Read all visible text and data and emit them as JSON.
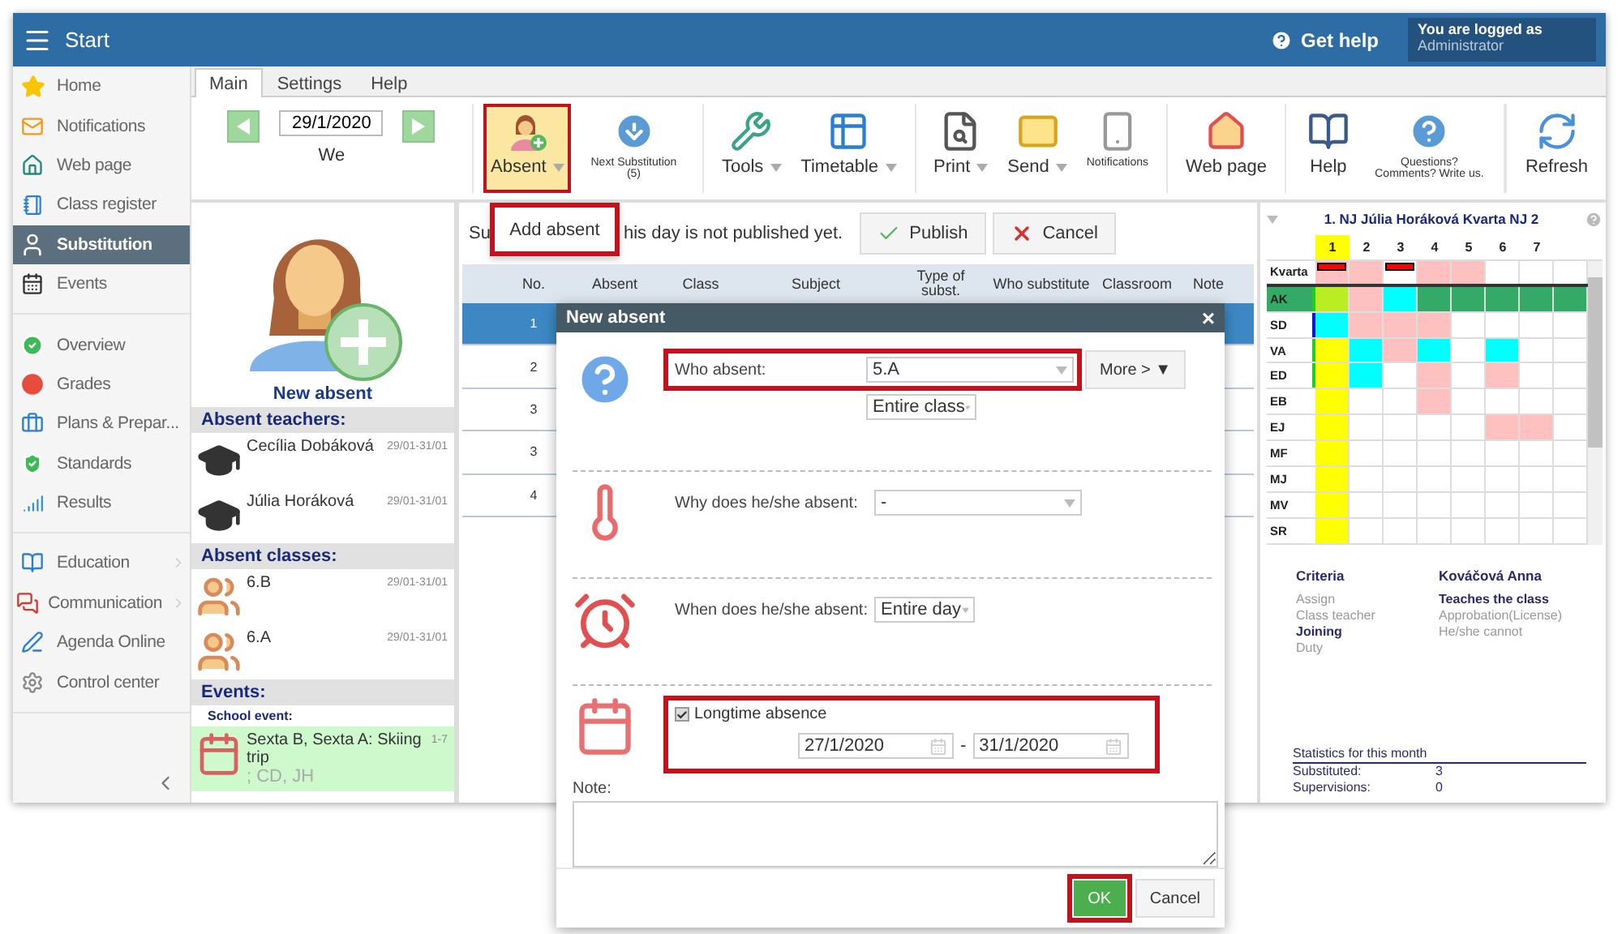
{
  "header": {
    "title": "Start",
    "help": "Get help",
    "login_caption": "You are logged as",
    "user": "Administrator"
  },
  "nav": [
    {
      "items": [
        {
          "label": "Home",
          "selected": false
        },
        {
          "label": "Notifications",
          "selected": false
        },
        {
          "label": "Web page",
          "selected": false
        },
        {
          "label": "Class register",
          "selected": false
        },
        {
          "label": "Substitution",
          "selected": true
        },
        {
          "label": "Events",
          "selected": false
        }
      ]
    },
    {
      "items": [
        {
          "label": "Overview",
          "selected": false
        },
        {
          "label": "Grades",
          "selected": false
        },
        {
          "label": "Plans & Prepar...",
          "selected": false
        },
        {
          "label": "Standards",
          "selected": false
        },
        {
          "label": "Results",
          "selected": false
        }
      ]
    },
    {
      "items": [
        {
          "label": "Education",
          "selected": false,
          "expandable": true
        },
        {
          "label": "Communication",
          "selected": false,
          "expandable": true
        },
        {
          "label": "Agenda Online",
          "selected": false
        },
        {
          "label": "Control center",
          "selected": false
        }
      ]
    }
  ],
  "tabs": [
    {
      "label": "Main",
      "selected": true
    },
    {
      "label": "Settings",
      "selected": false
    },
    {
      "label": "Help",
      "selected": false
    }
  ],
  "toolbar": {
    "date": "29/1/2020",
    "day": "We",
    "groups": [
      {
        "buttons": [
          {
            "label": "Absent",
            "dropdown": true,
            "highlighted": true,
            "callout": true
          },
          {
            "label": "Next Substitution (5)",
            "small": true
          }
        ]
      },
      {
        "buttons": [
          {
            "label": "Tools",
            "dropdown": true
          },
          {
            "label": "Timetable",
            "dropdown": true
          }
        ]
      },
      {
        "buttons": [
          {
            "label": "Print",
            "dropdown": true
          },
          {
            "label": "Send",
            "dropdown": true
          },
          {
            "label": "Notifications",
            "small": true
          }
        ]
      },
      {
        "buttons": [
          {
            "label": "Web page"
          }
        ]
      },
      {
        "buttons": [
          {
            "label": "Help"
          },
          {
            "label": "Questions? Comments? Write us.",
            "small": true
          }
        ]
      }
    ],
    "refresh": "Refresh"
  },
  "add_absent_menu": {
    "label": "Add absent",
    "callout": true
  },
  "new_absent": "New absent",
  "sections": [
    {
      "title": "Absent teachers:",
      "entries": [
        {
          "kind": "teacher",
          "name": "Cecília Dobáková",
          "dates": "29/01-31/01"
        },
        {
          "kind": "teacher",
          "name": "Júlia Horáková",
          "dates": "29/01-31/01"
        }
      ]
    },
    {
      "title": "Absent classes:",
      "entries": [
        {
          "kind": "class",
          "name": "6.B",
          "dates": "29/01-31/01"
        },
        {
          "kind": "class",
          "name": "6.A",
          "dates": "29/01-31/01"
        }
      ]
    },
    {
      "title": "Events:",
      "subtitle": "School event:",
      "entries": [
        {
          "kind": "event",
          "name": "Sexta B, Sexta A: Skiing trip",
          "dates": "1-7",
          "note": "; CD, JH"
        }
      ]
    }
  ],
  "notice": {
    "start": "Su",
    "end": "his day is not published yet."
  },
  "publish": "Publish",
  "cancel": "Cancel",
  "table": {
    "columns": [
      "No.",
      "Absent",
      "Class",
      "Subject",
      "Type of subst.",
      "Who substitute",
      "Classroom",
      "Note"
    ],
    "rows": [
      {
        "no": "1",
        "selected": true
      },
      {
        "no": "2",
        "selected": false
      },
      {
        "no": "3",
        "selected": false
      },
      {
        "no": "3",
        "selected": false
      },
      {
        "no": "4",
        "selected": false
      }
    ]
  },
  "dialog": {
    "title": "New absent",
    "close": "×",
    "who_label": "Who absent:",
    "who_value": "5.A",
    "who_callout": true,
    "more": "More > ▼",
    "scope": "Entire class",
    "why_label": "Why does he/she absent:",
    "why_value": "-",
    "when_label": "When does he/she absent:",
    "when_value": "Entire day",
    "longtime": {
      "label": "Longtime absence",
      "checked": true,
      "callout": true,
      "from": "27/1/2020",
      "dash": "-",
      "to": "31/1/2020"
    },
    "note_label": "Note:",
    "ok": "OK",
    "ok_callout": true,
    "cancel": "Cancel"
  },
  "grid": {
    "title": "1. NJ Júlia Horáková Kvarta NJ 2",
    "columns": [
      {
        "label": "1",
        "selected": true
      },
      {
        "label": "2",
        "selected": false
      },
      {
        "label": "3",
        "selected": false
      },
      {
        "label": "4",
        "selected": false
      },
      {
        "label": "5",
        "selected": false
      },
      {
        "label": "6",
        "selected": false
      },
      {
        "label": "7",
        "selected": false
      }
    ],
    "rows": [
      {
        "label": "Kvarta",
        "selected": false,
        "cells": [
          {
            "color": "#ffc0c0",
            "flag": true
          },
          {
            "color": "#ffc0c0"
          },
          {
            "color": "#ffffff",
            "flag": true
          },
          {
            "color": "#ffc0c0"
          },
          {
            "color": "#ffc0c0"
          },
          {
            "color": "#ffffff"
          },
          {
            "color": "#ffffff"
          },
          {
            "color": "#ffffff"
          }
        ]
      },
      {
        "label": "AK",
        "selected": true,
        "color": "#22cc22",
        "cells": [
          {
            "color": "#bbee22"
          },
          {
            "color": "#ffc0c0"
          },
          {
            "color": "#00ffff"
          },
          {
            "color": "#33aa66"
          },
          {
            "color": "#33aa66"
          },
          {
            "color": "#33aa66"
          },
          {
            "color": "#33aa66"
          },
          {
            "color": "#33aa66"
          }
        ]
      },
      {
        "label": "SD",
        "selected": false,
        "color": "#1111dd",
        "cells": [
          {
            "color": "#00ffff"
          },
          {
            "color": "#ffc0c0"
          },
          {
            "color": "#ffc0c0"
          },
          {
            "color": "#ffc0c0"
          },
          {
            "color": "#ffffff"
          },
          {
            "color": "#ffffff"
          },
          {
            "color": "#ffffff"
          },
          {
            "color": "#ffffff"
          }
        ]
      },
      {
        "label": "VA",
        "selected": false,
        "color": "#22cc22",
        "cells": [
          {
            "color": "#ffff00"
          },
          {
            "color": "#00ffff"
          },
          {
            "color": "#ffc0c0"
          },
          {
            "color": "#00ffff"
          },
          {
            "color": "#ffffff"
          },
          {
            "color": "#00ffff"
          },
          {
            "color": "#ffffff"
          },
          {
            "color": "#ffffff"
          }
        ]
      },
      {
        "label": "ED",
        "selected": false,
        "color": "#22cc22",
        "cells": [
          {
            "color": "#ffff00"
          },
          {
            "color": "#00ffff"
          },
          {
            "color": "#ffffff"
          },
          {
            "color": "#ffc0c0"
          },
          {
            "color": "#ffffff"
          },
          {
            "color": "#ffc0c0"
          },
          {
            "color": "#ffffff"
          },
          {
            "color": "#ffffff"
          }
        ]
      },
      {
        "label": "EB",
        "selected": false,
        "cells": [
          {
            "color": "#ffff00"
          },
          {
            "color": "#ffffff"
          },
          {
            "color": "#ffffff"
          },
          {
            "color": "#ffc0c0"
          },
          {
            "color": "#ffffff"
          },
          {
            "color": "#ffffff"
          },
          {
            "color": "#ffffff"
          },
          {
            "color": "#ffffff"
          }
        ]
      },
      {
        "label": "EJ",
        "selected": false,
        "cells": [
          {
            "color": "#ffff00"
          },
          {
            "color": "#ffffff"
          },
          {
            "color": "#ffffff"
          },
          {
            "color": "#ffffff"
          },
          {
            "color": "#ffffff"
          },
          {
            "color": "#ffc0c0"
          },
          {
            "color": "#ffc0c0"
          },
          {
            "color": "#ffffff"
          }
        ]
      },
      {
        "label": "MF",
        "selected": false,
        "cells": [
          {
            "color": "#ffff00"
          },
          {
            "color": "#ffffff"
          },
          {
            "color": "#ffffff"
          },
          {
            "color": "#ffffff"
          },
          {
            "color": "#ffffff"
          },
          {
            "color": "#ffffff"
          },
          {
            "color": "#ffffff"
          },
          {
            "color": "#ffffff"
          }
        ]
      },
      {
        "label": "MJ",
        "selected": false,
        "cells": [
          {
            "color": "#ffff00"
          },
          {
            "color": "#ffffff"
          },
          {
            "color": "#ffffff"
          },
          {
            "color": "#ffffff"
          },
          {
            "color": "#ffffff"
          },
          {
            "color": "#ffffff"
          },
          {
            "color": "#ffffff"
          },
          {
            "color": "#ffffff"
          }
        ]
      },
      {
        "label": "MV",
        "selected": false,
        "cells": [
          {
            "color": "#ffff00"
          },
          {
            "color": "#ffffff"
          },
          {
            "color": "#ffffff"
          },
          {
            "color": "#ffffff"
          },
          {
            "color": "#ffffff"
          },
          {
            "color": "#ffffff"
          },
          {
            "color": "#ffffff"
          },
          {
            "color": "#ffffff"
          }
        ]
      },
      {
        "label": "SR",
        "selected": false,
        "cells": [
          {
            "color": "#ffff00"
          },
          {
            "color": "#ffffff"
          },
          {
            "color": "#ffffff"
          },
          {
            "color": "#ffffff"
          },
          {
            "color": "#ffffff"
          },
          {
            "color": "#ffffff"
          },
          {
            "color": "#ffffff"
          },
          {
            "color": "#ffffff"
          }
        ]
      }
    ]
  },
  "criteria": [
    {
      "title": "Criteria",
      "items": [
        {
          "label": "Assign",
          "active": false
        },
        {
          "label": "Class teacher",
          "active": false
        },
        {
          "label": "Joining",
          "active": true
        },
        {
          "label": "Duty",
          "active": false
        }
      ]
    },
    {
      "title": "Kováčová Anna",
      "items": [
        {
          "label": "Teaches the class",
          "active": true
        },
        {
          "label": "Approbation(License)",
          "active": false
        },
        {
          "label": "He/she cannot",
          "active": false
        }
      ]
    }
  ],
  "stats": {
    "title": "Statistics for this month",
    "rows": [
      {
        "label": "Substituted:",
        "value": "3"
      },
      {
        "label": "Supervisions:",
        "value": "0"
      }
    ]
  }
}
